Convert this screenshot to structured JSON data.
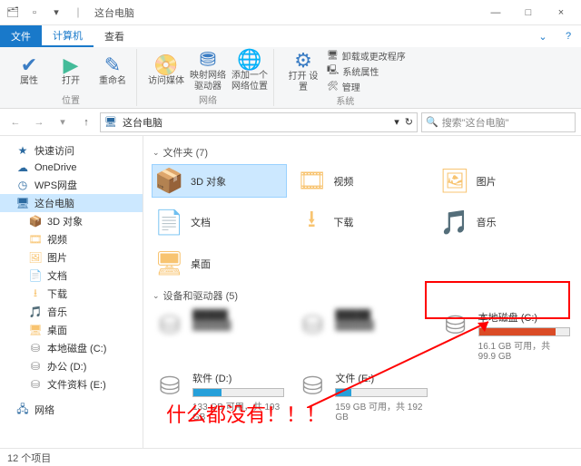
{
  "titlebar": {
    "app_title": "这台电脑",
    "min": "—",
    "max": "□",
    "close": "×"
  },
  "ribbon_tabs": {
    "file": "文件",
    "computer": "计算机",
    "view": "查看"
  },
  "ribbon": {
    "position_group": "位置",
    "properties": "属性",
    "open": "打开",
    "rename": "重命名",
    "network_group": "网络",
    "access_media": "访问媒体",
    "map_drive": "映射网络\n驱动器",
    "add_net": "添加一个\n网络位置",
    "system_group": "系统",
    "open_settings": "打开\n设置",
    "uninstall": "卸载或更改程序",
    "sys_props": "系统属性",
    "manage": "管理"
  },
  "nav": {
    "location": "这台电脑",
    "search_placeholder": "搜索\"这台电脑\""
  },
  "sidebar": {
    "items": [
      {
        "label": "快速访问",
        "icon": "★",
        "cls": "c-blue"
      },
      {
        "label": "OneDrive",
        "icon": "☁",
        "cls": "c-blue"
      },
      {
        "label": "WPS网盘",
        "icon": "◷",
        "cls": "c-blue"
      },
      {
        "label": "这台电脑",
        "icon": "🖥",
        "cls": "c-blue",
        "active": true
      },
      {
        "label": "3D 对象",
        "icon": "📦",
        "cls": "c-folder",
        "sub": true
      },
      {
        "label": "视频",
        "icon": "🎞",
        "cls": "c-folder",
        "sub": true
      },
      {
        "label": "图片",
        "icon": "🖼",
        "cls": "c-folder",
        "sub": true
      },
      {
        "label": "文档",
        "icon": "📄",
        "cls": "c-folder",
        "sub": true
      },
      {
        "label": "下载",
        "icon": "⭳",
        "cls": "c-folder",
        "sub": true
      },
      {
        "label": "音乐",
        "icon": "🎵",
        "cls": "c-folder",
        "sub": true
      },
      {
        "label": "桌面",
        "icon": "🖥",
        "cls": "c-folder",
        "sub": true
      },
      {
        "label": "本地磁盘 (C:)",
        "icon": "⛁",
        "cls": "c-drive",
        "sub": true
      },
      {
        "label": "办公 (D:)",
        "icon": "⛁",
        "cls": "c-drive",
        "sub": true
      },
      {
        "label": "文件资料 (E:)",
        "icon": "⛁",
        "cls": "c-drive",
        "sub": true
      },
      {
        "label": "网络",
        "icon": "🖧",
        "cls": "c-blue",
        "secondary": true
      }
    ]
  },
  "main": {
    "folders_header": "文件夹 (7)",
    "drives_header": "设备和驱动器 (5)",
    "folders": [
      {
        "label": "3D 对象",
        "icon": "📦",
        "selected": true
      },
      {
        "label": "视频",
        "icon": "🎞"
      },
      {
        "label": "图片",
        "icon": "🖼"
      },
      {
        "label": "文档",
        "icon": "📄"
      },
      {
        "label": "下载",
        "icon": "⭳"
      },
      {
        "label": "音乐",
        "icon": "🎵"
      },
      {
        "label": "桌面",
        "icon": "🖥"
      }
    ],
    "drives": [
      {
        "name": "",
        "blur": true
      },
      {
        "name": "",
        "blur": true
      },
      {
        "name": "本地磁盘 (C:)",
        "fill": 85,
        "red": true,
        "space": "16.1 GB 可用，共 99.9 GB"
      },
      {
        "name": "软件 (D:)",
        "fill": 31,
        "space": "133 GB 可用，共 193 GB"
      },
      {
        "name": "文件 (E:)",
        "fill": 17,
        "space": "159 GB 可用，共 192 GB"
      }
    ]
  },
  "statusbar": {
    "text": "12 个项目"
  },
  "annotation": {
    "text": "什么都没有！！！"
  }
}
